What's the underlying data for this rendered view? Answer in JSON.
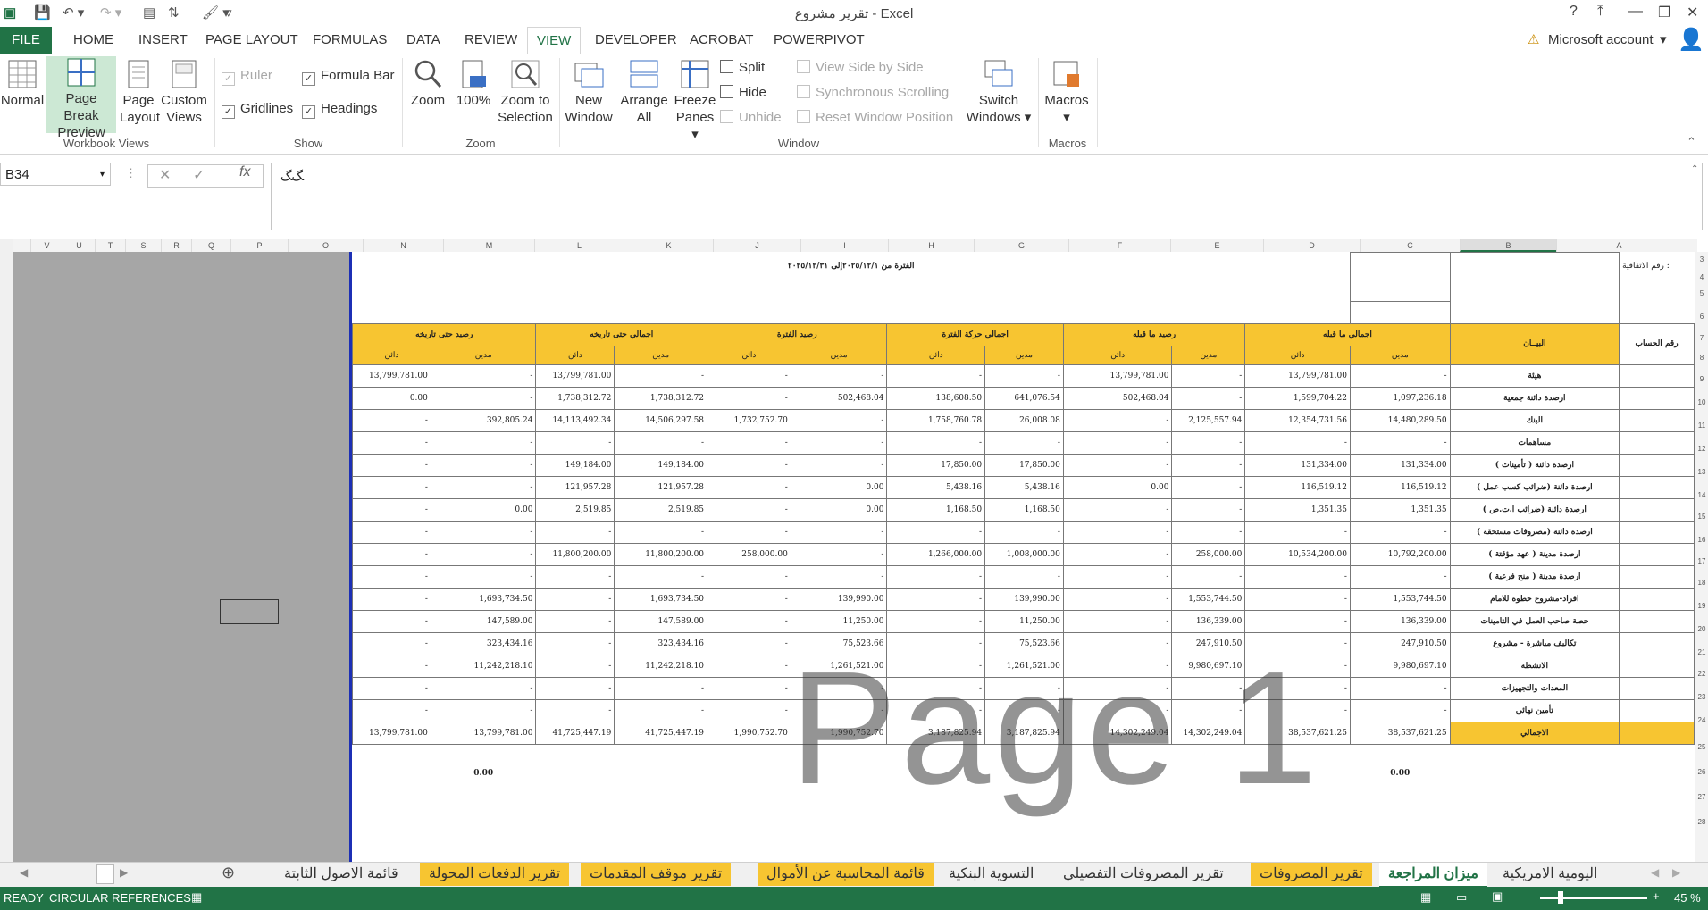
{
  "window": {
    "title": "تقرير مشروع - Excel",
    "help": "?",
    "account": "Microsoft account"
  },
  "ribbon_tabs": [
    "FILE",
    "HOME",
    "INSERT",
    "PAGE LAYOUT",
    "FORMULAS",
    "DATA",
    "REVIEW",
    "VIEW",
    "DEVELOPER",
    "ACROBAT",
    "POWERPIVOT"
  ],
  "ribbon": {
    "workbook_views": {
      "label": "Workbook Views",
      "normal": "Normal",
      "page_break_1": "Page Break",
      "page_break_2": "Preview",
      "page_layout_1": "Page",
      "page_layout_2": "Layout",
      "custom_1": "Custom",
      "custom_2": "Views"
    },
    "show": {
      "label": "Show",
      "ruler": "Ruler",
      "formula_bar": "Formula Bar",
      "gridlines": "Gridlines",
      "headings": "Headings"
    },
    "zoom": {
      "label": "Zoom",
      "zoom": "Zoom",
      "hundred": "100%",
      "zts_1": "Zoom to",
      "zts_2": "Selection"
    },
    "window": {
      "label": "Window",
      "new_1": "New",
      "new_2": "Window",
      "arrange_1": "Arrange",
      "arrange_2": "All",
      "freeze_1": "Freeze",
      "freeze_2": "Panes",
      "split": "Split",
      "hide": "Hide",
      "unhide": "Unhide",
      "side": "View Side by Side",
      "sync": "Synchronous Scrolling",
      "reset": "Reset Window Position",
      "switch_1": "Switch",
      "switch_2": "Windows"
    },
    "macros": {
      "label": "Macros",
      "button": "Macros"
    }
  },
  "formula_bar": {
    "name_box": "B34",
    "content": "ﮓﮓ"
  },
  "columns": [
    "V",
    "U",
    "T",
    "S",
    "R",
    "Q",
    "P",
    "O",
    "N",
    "M",
    "L",
    "K",
    "J",
    "I",
    "H",
    "G",
    "F",
    "E",
    "D",
    "C",
    "B",
    "A"
  ],
  "rows": [
    "3",
    "4",
    "5",
    "6",
    "7",
    "8",
    "9",
    "10",
    "11",
    "12",
    "13",
    "14",
    "15",
    "16",
    "17",
    "18",
    "19",
    "20",
    "21",
    "22",
    "23",
    "24",
    "25",
    "26",
    "27",
    "28"
  ],
  "report": {
    "contract_label": "رقم الاتفاقية :",
    "period": "الفترة من  ٢٠٢٥/١٢/١إلى ٢٠٢٥/١٢/٣١",
    "headers": [
      "رصيد حتى تاريخه",
      "اجمالي حتى تاريخه",
      "رصيد الفترة",
      "اجمالي حركة الفترة",
      "رصيد ما قبله",
      "اجمالي ما قبله"
    ],
    "items_header": "البيــان",
    "num_header": "رقم الحساب",
    "credit": "دائن",
    "debit": "مدين",
    "rows": [
      {
        "label": "هيئة",
        "v": [
          "13,799,781.00",
          "-",
          "13,799,781.00",
          "-",
          "-",
          "-",
          "-",
          "-",
          "13,799,781.00",
          "-",
          "13,799,781.00",
          "-"
        ]
      },
      {
        "label": "ارصدة دائنة جمعية",
        "v": [
          "0.00",
          "-",
          "1,738,312.72",
          "1,738,312.72",
          "-",
          "502,468.04",
          "138,608.50",
          "641,076.54",
          "502,468.04",
          "-",
          "1,599,704.22",
          "1,097,236.18"
        ]
      },
      {
        "label": "البنك",
        "v": [
          "-",
          "392,805.24",
          "14,113,492.34",
          "14,506,297.58",
          "1,732,752.70",
          "-",
          "1,758,760.78",
          "26,008.08",
          "-",
          "2,125,557.94",
          "12,354,731.56",
          "14,480,289.50"
        ]
      },
      {
        "label": "مساهمات",
        "v": [
          "-",
          "-",
          "-",
          "-",
          "-",
          "-",
          "-",
          "-",
          "-",
          "-",
          "-",
          "-"
        ]
      },
      {
        "label": "ارصدة دائنة ( تأمينات )",
        "v": [
          "-",
          "-",
          "149,184.00",
          "149,184.00",
          "-",
          "-",
          "17,850.00",
          "17,850.00",
          "-",
          "-",
          "131,334.00",
          "131,334.00"
        ]
      },
      {
        "label": "ارصدة دائنة (ضرائب كسب عمل )",
        "v": [
          "-",
          "-",
          "121,957.28",
          "121,957.28",
          "-",
          "0.00",
          "5,438.16",
          "5,438.16",
          "0.00",
          "-",
          "116,519.12",
          "116,519.12"
        ]
      },
      {
        "label": "ارصدة دائنة (ضرائب ا.ت.ص )",
        "v": [
          "-",
          "0.00",
          "2,519.85",
          "2,519.85",
          "-",
          "0.00",
          "1,168.50",
          "1,168.50",
          "-",
          "-",
          "1,351.35",
          "1,351.35"
        ]
      },
      {
        "label": "ارصدة دائنة (مصروفات مستحقة )",
        "v": [
          "-",
          "-",
          "-",
          "-",
          "-",
          "-",
          "-",
          "-",
          "-",
          "-",
          "-",
          "-"
        ]
      },
      {
        "label": "ارصدة مدينة ( عهد مؤقتة )",
        "v": [
          "-",
          "-",
          "11,800,200.00",
          "11,800,200.00",
          "258,000.00",
          "-",
          "1,266,000.00",
          "1,008,000.00",
          "-",
          "258,000.00",
          "10,534,200.00",
          "10,792,200.00"
        ]
      },
      {
        "label": "ارصدة مدينة ( منح فرعية )",
        "v": [
          "-",
          "-",
          "-",
          "-",
          "-",
          "-",
          "-",
          "-",
          "-",
          "-",
          "-",
          "-"
        ]
      },
      {
        "label": "افراد-مشروع خطوة للامام",
        "v": [
          "-",
          "1,693,734.50",
          "-",
          "1,693,734.50",
          "-",
          "139,990.00",
          "-",
          "139,990.00",
          "-",
          "1,553,744.50",
          "-",
          "1,553,744.50"
        ]
      },
      {
        "label": "حصة صاحب العمل في التامينات",
        "v": [
          "-",
          "147,589.00",
          "-",
          "147,589.00",
          "-",
          "11,250.00",
          "-",
          "11,250.00",
          "-",
          "136,339.00",
          "-",
          "136,339.00"
        ]
      },
      {
        "label": "تكاليف مباشرة - مشروع",
        "v": [
          "-",
          "323,434.16",
          "-",
          "323,434.16",
          "-",
          "75,523.66",
          "-",
          "75,523.66",
          "-",
          "247,910.50",
          "-",
          "247,910.50"
        ]
      },
      {
        "label": "الانشطة",
        "v": [
          "-",
          "11,242,218.10",
          "-",
          "11,242,218.10",
          "-",
          "1,261,521.00",
          "-",
          "1,261,521.00",
          "-",
          "9,980,697.10",
          "-",
          "9,980,697.10"
        ]
      },
      {
        "label": "المعدات والتجهيزات",
        "v": [
          "-",
          "-",
          "-",
          "-",
          "-",
          "-",
          "-",
          "-",
          "-",
          "-",
          "-",
          "-"
        ]
      },
      {
        "label": "تأمين نهائي",
        "v": [
          "-",
          "-",
          "-",
          "-",
          "-",
          "-",
          "-",
          "-",
          "-",
          "-",
          "-",
          "-"
        ]
      }
    ],
    "total": {
      "label": "الاجمالي",
      "v": [
        "13,799,781.00",
        "13,799,781.00",
        "41,725,447.19",
        "41,725,447.19",
        "1,990,752.70",
        "1,990,752.70",
        "3,187,825.94",
        "3,187,825.94",
        "14,302,249.04",
        "14,302,249.04",
        "38,537,621.25",
        "38,537,621.25"
      ]
    },
    "footer_left": "0.00",
    "footer_right": "0.00",
    "watermark": "Page 1"
  },
  "sheet_tabs": [
    {
      "name": "قائمة الاصول الثابتة",
      "style": "normal"
    },
    {
      "name": "تقرير الدفعات المحولة",
      "style": "orange"
    },
    {
      "name": "تقرير موقف المقدمات",
      "style": "orange"
    },
    {
      "name": "قائمة المحاسبة عن الأموال",
      "style": "orange"
    },
    {
      "name": "التسوية البنكية",
      "style": "normal"
    },
    {
      "name": "تقرير المصروفات التفصيلي",
      "style": "normal"
    },
    {
      "name": "تقرير المصروفات",
      "style": "orange"
    },
    {
      "name": "ميزان المراجعة",
      "style": "active"
    },
    {
      "name": "اليومية الامريكية",
      "style": "normal"
    }
  ],
  "status": {
    "ready": "READY",
    "circ": "CIRCULAR REFERENCES",
    "zoom": "45 %"
  },
  "colors": {
    "accent": "#217346",
    "header_fill": "#f7c531",
    "page_border": "#1c2fb5"
  }
}
